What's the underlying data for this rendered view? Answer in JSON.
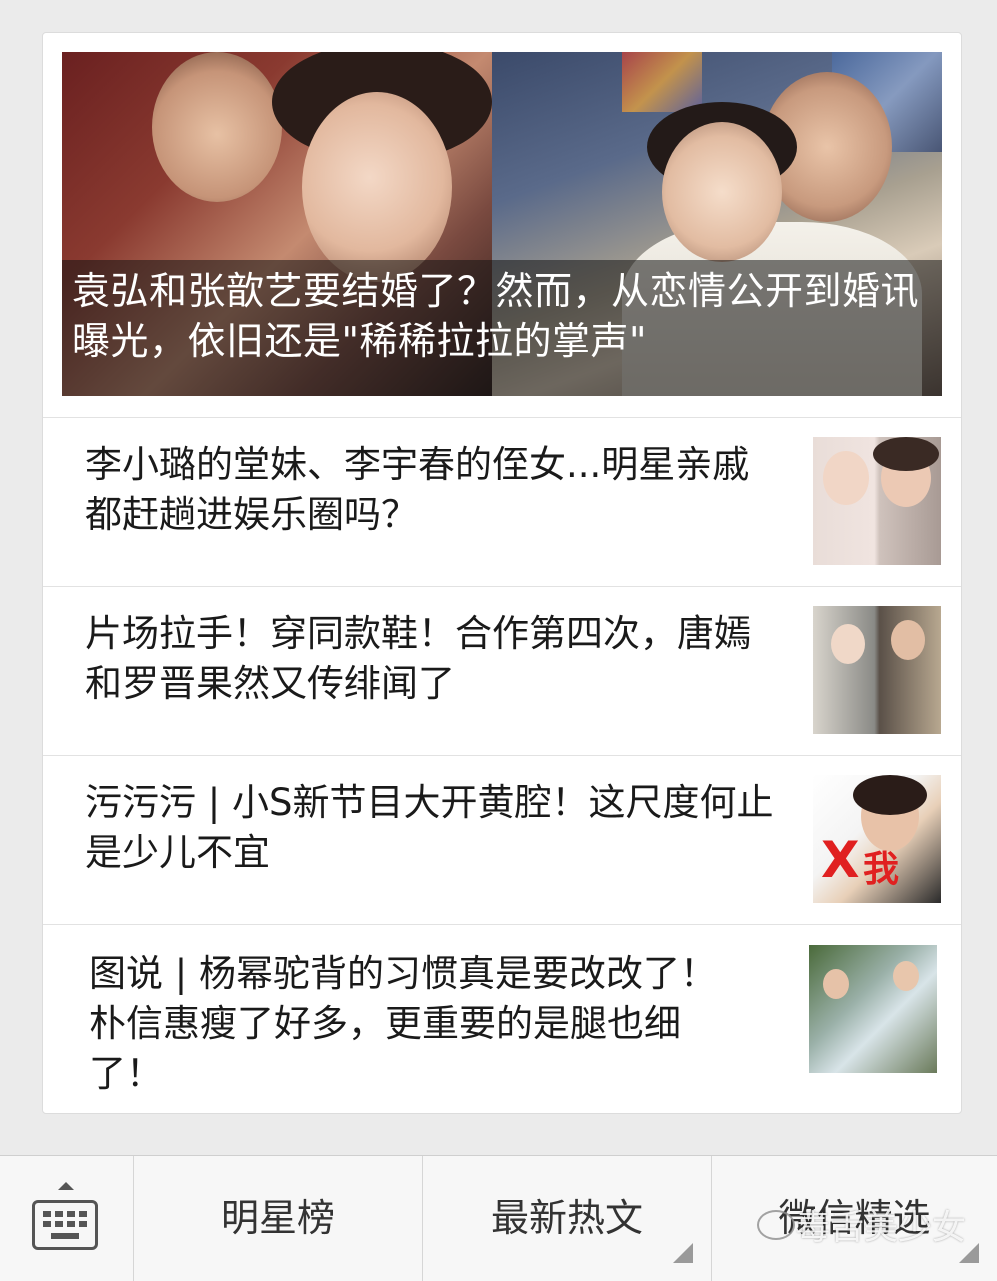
{
  "feed": {
    "hero": {
      "title": "袁弘和张歆艺要结婚了？然而，从恋情公开到婚讯曝光，依旧还是\"稀稀拉拉的掌声\""
    },
    "items": [
      {
        "title": "李小璐的堂妹、李宇春的侄女...明星亲戚都赶趟进娱乐圈吗？"
      },
      {
        "title": "片场拉手！穿同款鞋！合作第四次，唐嫣和罗晋果然又传绯闻了"
      },
      {
        "title": "污污污 | 小S新节目大开黄腔！这尺度何止是少儿不宜",
        "thumb_overlay": [
          "X",
          "我"
        ]
      },
      {
        "title": "图说 | 杨幂驼背的习惯真是要改改了！朴信惠瘦了好多，更重要的是腿也细了！"
      }
    ]
  },
  "tabbar": {
    "keyboard_icon": "keyboard-icon",
    "tabs": [
      {
        "label": "明星榜"
      },
      {
        "label": "最新热文"
      },
      {
        "label": "微信精选"
      }
    ]
  },
  "watermark": {
    "text": "毒舌美少女"
  },
  "colors": {
    "background": "#ebebeb",
    "card": "#ffffff",
    "text": "#1a1a1a",
    "tab_text": "#333333"
  }
}
